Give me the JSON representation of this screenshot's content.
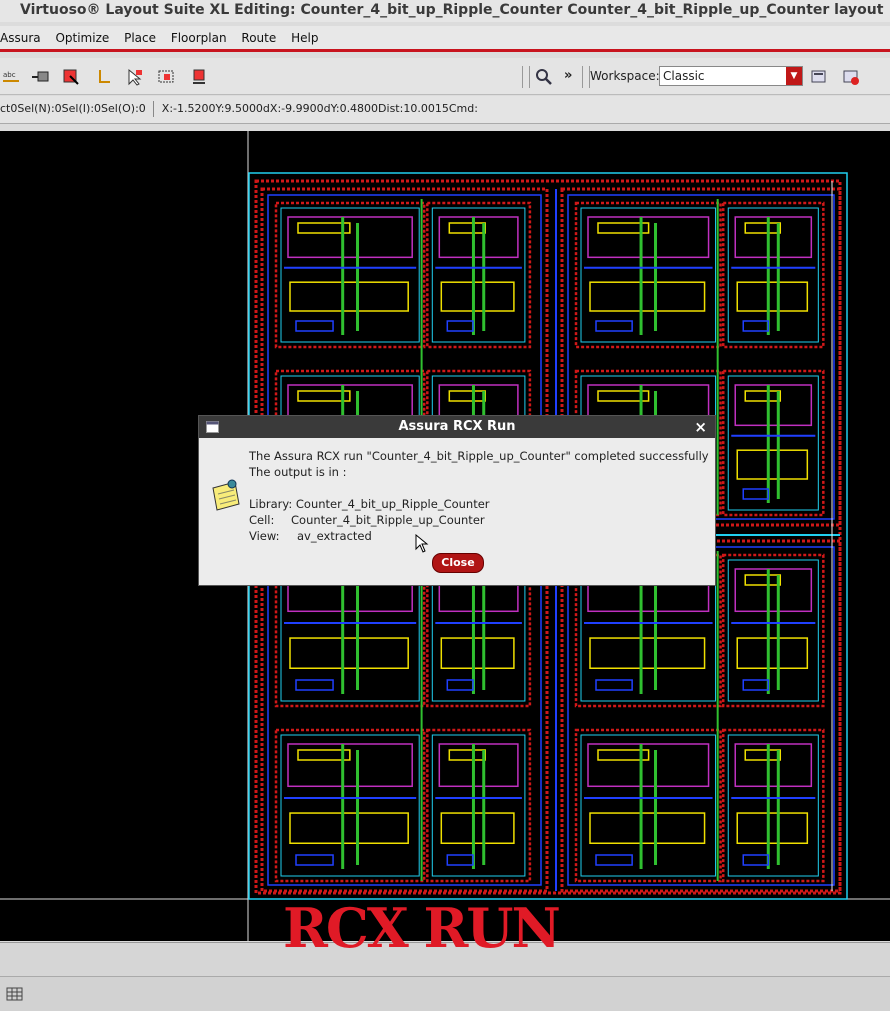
{
  "window": {
    "title": "Virtuoso® Layout Suite XL Editing: Counter_4_bit_up_Ripple_Counter Counter_4_bit_Ripple_up_Counter layout"
  },
  "menu": [
    "Assura",
    "Optimize",
    "Place",
    "Floorplan",
    "Route",
    "Help"
  ],
  "toolbar": {
    "workspace_label": "Workspace:",
    "workspace_value": "Classic"
  },
  "status": {
    "selection": "ct0Sel(N):0Sel(I):0Sel(O):0",
    "coords": "X:-1.5200Y:9.5000dX:-9.9900dY:0.4800Dist:10.0015Cmd:"
  },
  "dialog": {
    "title": "Assura RCX Run",
    "message": "The Assura RCX run \"Counter_4_bit_Ripple_up_Counter\" completed successfully",
    "output_line": "The output is in :",
    "library_label": "Library:",
    "library_value": "Counter_4_bit_up_Ripple_Counter",
    "cell_label": "Cell:",
    "cell_value": "Counter_4_bit_Ripple_up_Counter",
    "view_label": "View:",
    "view_value": "av_extracted",
    "close_label": "Close",
    "close_x": "×"
  },
  "overlay_text": "RCX RUN",
  "colors": {
    "accent": "#c8141e",
    "canvas": "#000000",
    "layout_red": "#d01818",
    "layout_blue": "#2040ff",
    "layout_green": "#30c030",
    "layout_cyan": "#20d0f0",
    "layout_yellow": "#f0e000"
  }
}
